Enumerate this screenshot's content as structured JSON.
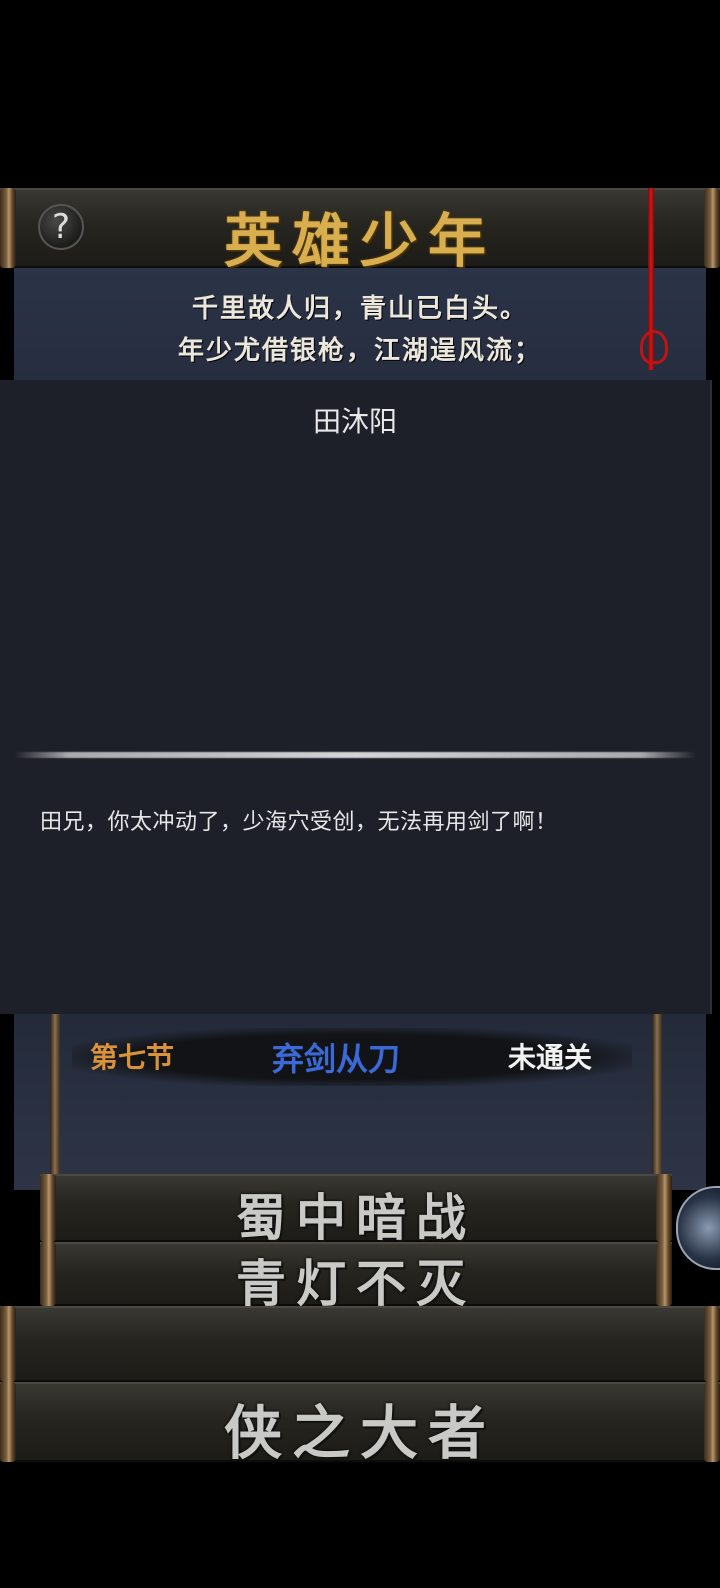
{
  "header": {
    "title": "英雄少年",
    "help_icon": "?"
  },
  "poem": {
    "lines": [
      "千里故人归，青山已白头。",
      "年少尤借银枪，江湖逞风流；"
    ]
  },
  "dialog": {
    "speaker": "田沐阳",
    "text": "田兄，你太冲动了，少海穴受创，无法再用剑了啊！"
  },
  "chapter": {
    "number": "第七节",
    "name": "弃剑从刀",
    "status": "未通关"
  },
  "scrolls": {
    "item1": "蜀中暗战",
    "item2": "青灯不灭",
    "item3": "",
    "item4": "侠之大者"
  },
  "colors": {
    "title_gold": "#d9ae4e",
    "chapter_number": "#d9923a",
    "chapter_name": "#3b6ad8",
    "chapter_status": "#f2f2f2",
    "dialog_bg": "#1e2029",
    "cord_red": "#d01818"
  }
}
